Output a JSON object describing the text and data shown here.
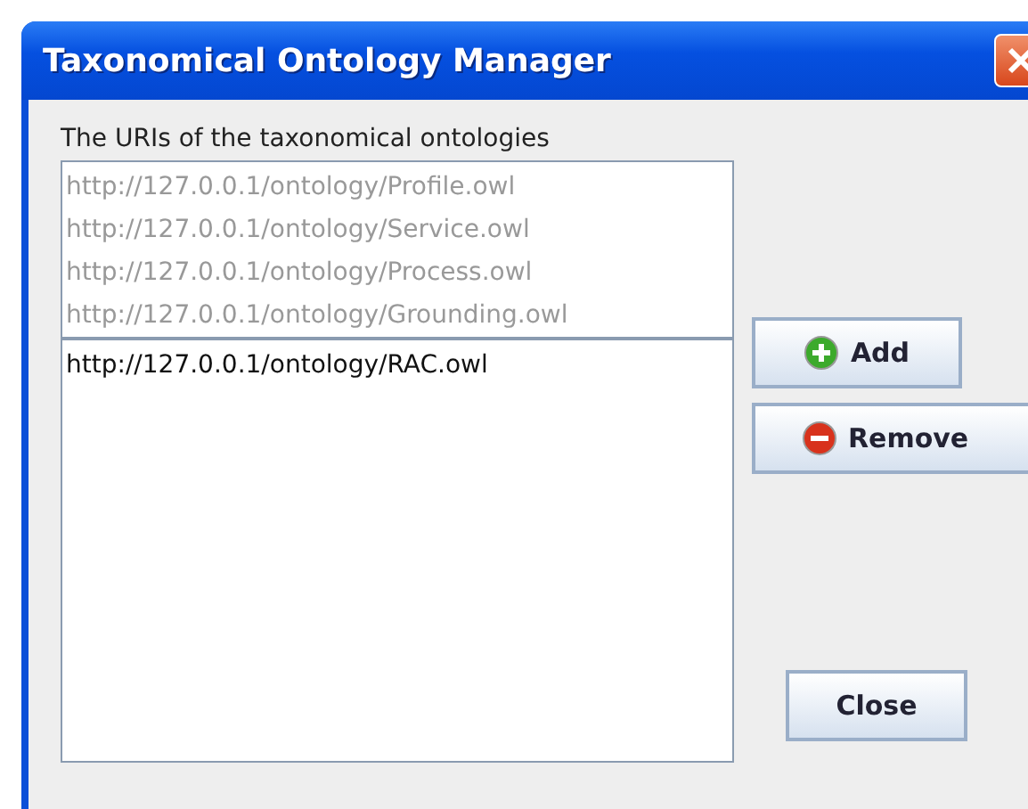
{
  "window": {
    "title": "Taxonomical Ontology Manager"
  },
  "label": "The URIs of the taxonomical ontologies",
  "default_list": [
    {
      "text": "http://127.0.0.1/ontology/Profile.owl",
      "disabled": true
    },
    {
      "text": "http://127.0.0.1/ontology/Service.owl",
      "disabled": true
    },
    {
      "text": "http://127.0.0.1/ontology/Process.owl",
      "disabled": true
    },
    {
      "text": "http://127.0.0.1/ontology/Grounding.owl",
      "disabled": true
    }
  ],
  "user_list": [
    {
      "text": "http://127.0.0.1/ontology/RAC.owl",
      "disabled": false
    }
  ],
  "buttons": [
    {
      "kind": "add",
      "label": "Add"
    },
    {
      "kind": "remove",
      "label": "Remove"
    },
    {
      "kind": "close",
      "label": "Close"
    }
  ]
}
